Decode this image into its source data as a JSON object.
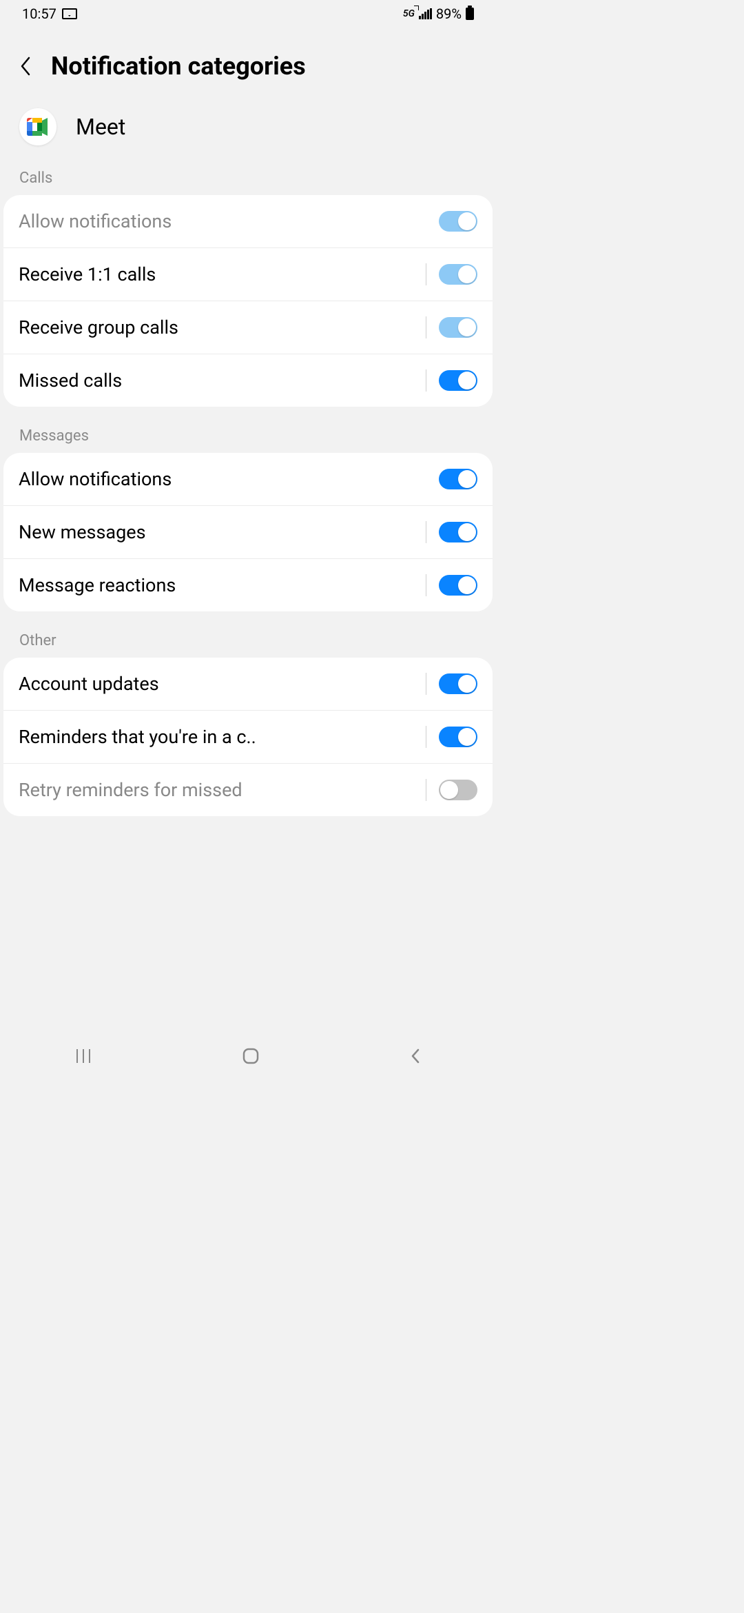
{
  "status_bar": {
    "time": "10:57",
    "network": "5G",
    "battery": "89%"
  },
  "header": {
    "title": "Notification categories"
  },
  "app": {
    "name": "Meet"
  },
  "sections": {
    "calls": {
      "header": "Calls",
      "items": [
        {
          "label": "Allow notifications",
          "on": true,
          "tone": "light",
          "divider": false,
          "dim": true
        },
        {
          "label": "Receive 1:1 calls",
          "on": true,
          "tone": "light",
          "divider": true
        },
        {
          "label": "Receive group calls",
          "on": true,
          "tone": "light",
          "divider": true
        },
        {
          "label": "Missed calls",
          "on": true,
          "tone": "strong",
          "divider": true
        }
      ]
    },
    "messages": {
      "header": "Messages",
      "items": [
        {
          "label": "Allow notifications",
          "on": true,
          "tone": "strong",
          "divider": false
        },
        {
          "label": "New messages",
          "on": true,
          "tone": "strong",
          "divider": true
        },
        {
          "label": "Message reactions",
          "on": true,
          "tone": "strong",
          "divider": true
        }
      ]
    },
    "other": {
      "header": "Other",
      "items": [
        {
          "label": "Account updates",
          "on": true,
          "tone": "strong",
          "divider": true
        },
        {
          "label": "Reminders that you're in a c..",
          "on": true,
          "tone": "strong",
          "divider": true
        },
        {
          "label": "Retry reminders for missed",
          "on": false,
          "tone": "off",
          "divider": true,
          "truncated": true
        }
      ]
    }
  }
}
